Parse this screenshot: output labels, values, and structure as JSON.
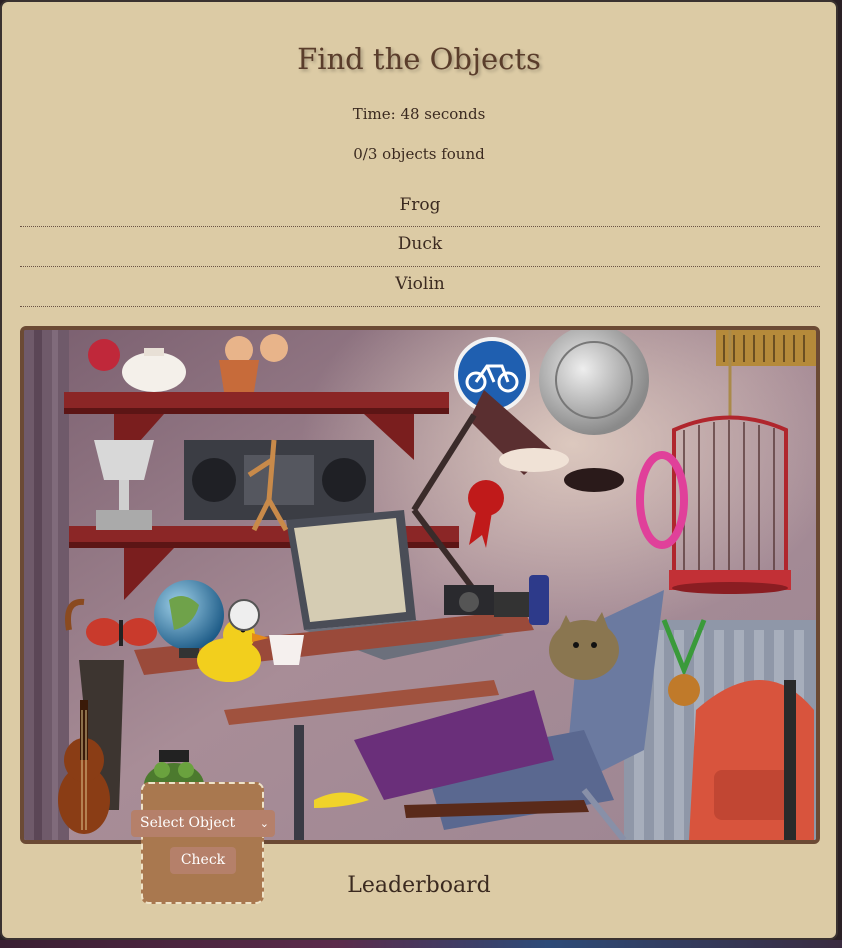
{
  "title": "Find the Objects",
  "timer": "Time: 48 seconds",
  "progress": "0/3 objects found",
  "objects": [
    "Frog",
    "Duck",
    "Violin"
  ],
  "scene": {
    "sign_label": "bicycle-sign"
  },
  "controls": {
    "select_label": "Select Object",
    "check_label": "Check"
  },
  "leaderboard_title": "Leaderboard",
  "colors": {
    "background": "#dccba5",
    "accent": "#b5806a",
    "frame": "#6b4a34"
  }
}
